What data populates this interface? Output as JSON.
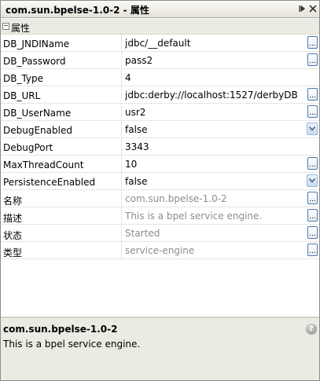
{
  "window": {
    "title": "com.sun.bpelse-1.0-2 - 属性",
    "pin_icon": "pin-icon",
    "close_icon": "close-icon"
  },
  "section": {
    "toggle_symbol": "−",
    "label": "属性"
  },
  "properties": [
    {
      "name": "DB_JNDIName",
      "value": "jdbc/__default",
      "editor": "ellipsis",
      "readonly": false
    },
    {
      "name": "DB_Password",
      "value": "pass2",
      "editor": "ellipsis",
      "readonly": false
    },
    {
      "name": "DB_Type",
      "value": "4",
      "editor": "none",
      "readonly": false
    },
    {
      "name": "DB_URL",
      "value": "jdbc:derby://localhost:1527/derbyDB",
      "editor": "ellipsis",
      "readonly": false
    },
    {
      "name": "DB_UserName",
      "value": "usr2",
      "editor": "ellipsis",
      "readonly": false
    },
    {
      "name": "DebugEnabled",
      "value": "false",
      "editor": "combo",
      "readonly": false
    },
    {
      "name": "DebugPort",
      "value": "3343",
      "editor": "none",
      "readonly": false
    },
    {
      "name": "MaxThreadCount",
      "value": "10",
      "editor": "ellipsis",
      "readonly": false
    },
    {
      "name": "PersistenceEnabled",
      "value": "false",
      "editor": "combo",
      "readonly": false
    },
    {
      "name": "名称",
      "value": "com.sun.bpelse-1.0-2",
      "editor": "ellipsis",
      "readonly": true
    },
    {
      "name": "描述",
      "value": "This is a bpel service engine.",
      "editor": "ellipsis",
      "readonly": true
    },
    {
      "name": "状态",
      "value": "Started",
      "editor": "ellipsis",
      "readonly": true
    },
    {
      "name": "类型",
      "value": "service-engine",
      "editor": "ellipsis",
      "readonly": true
    }
  ],
  "ellipsis_label": "...",
  "description": {
    "title": "com.sun.bpelse-1.0-2",
    "text": "This is a bpel service engine.",
    "help_label": "?"
  },
  "colors": {
    "readonly_text": "#8c8c8c",
    "panel_background": "#ecebe3",
    "button_border": "#4a78b0"
  }
}
